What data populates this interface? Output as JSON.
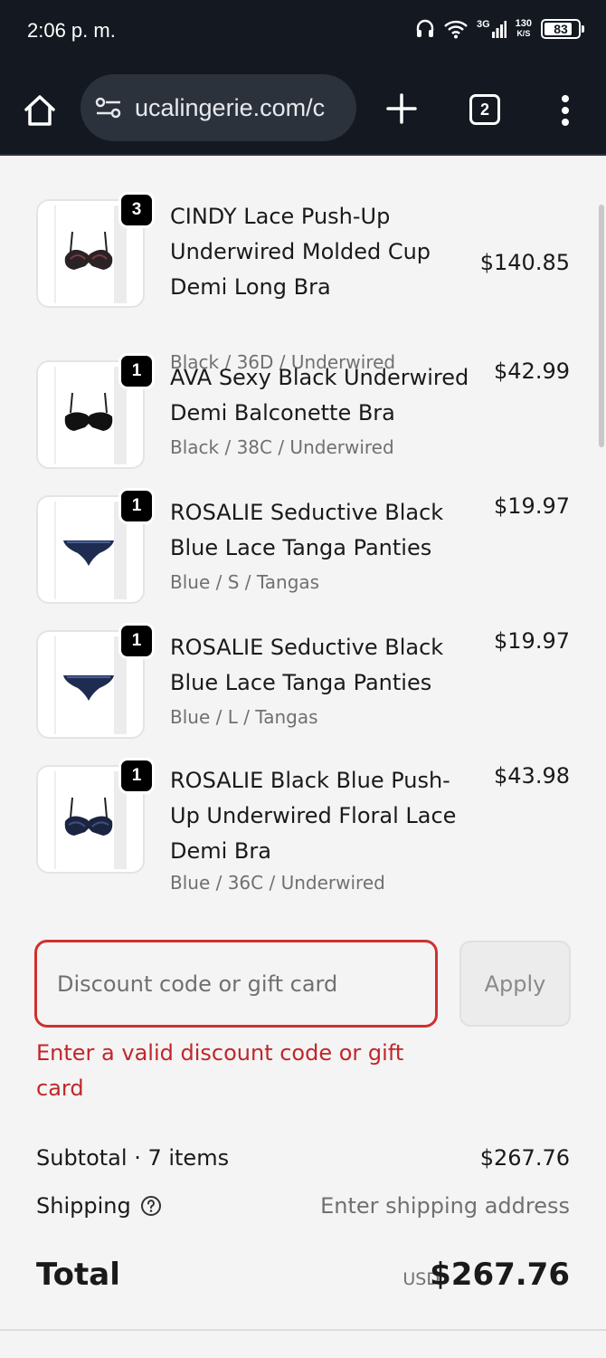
{
  "status_bar": {
    "time": "2:06 p. m.",
    "network": "3G",
    "speed_value": "130",
    "speed_unit": "K/S",
    "battery": "83",
    "battery_level": 0.83
  },
  "browser": {
    "url": "ucalingerie.com/c",
    "tab_count": "2",
    "icons": [
      "home-icon",
      "site-settings-icon",
      "plus-icon",
      "tabs-icon",
      "more-vert-icon"
    ]
  },
  "cart": {
    "items": [
      {
        "quantity": "3",
        "title": "CINDY Lace Push-Up Underwired Molded Cup Demi Long Bra",
        "variant": "Black / 36D / Underwired",
        "price": "$140.85"
      },
      {
        "quantity": "1",
        "title": "AVA Sexy Black Underwired Demi Balconette Bra",
        "variant": "Black / 38C / Underwired",
        "price": "$42.99"
      },
      {
        "quantity": "1",
        "title": "ROSALIE Seductive Black Blue Lace Tanga Panties",
        "variant": "Blue / S / Tangas",
        "price": "$19.97"
      },
      {
        "quantity": "1",
        "title": "ROSALIE Seductive Black Blue Lace Tanga Panties",
        "variant": "Blue / L / Tangas",
        "price": "$19.97"
      },
      {
        "quantity": "1",
        "title": "ROSALIE Black Blue Push-Up Underwired Floral Lace Demi Bra",
        "variant": "Blue / 36C / Underwired",
        "price": "$43.98"
      }
    ]
  },
  "discount": {
    "placeholder": "Discount code or gift card",
    "value": "",
    "apply_label": "Apply",
    "error": "Enter a valid discount code or gift card"
  },
  "summary": {
    "subtotal_label": "Subtotal · 7 items",
    "subtotal_value": "$267.76",
    "shipping_label": "Shipping",
    "shipping_value": "Enter shipping address",
    "total_label": "Total",
    "currency": "USD",
    "total_value": "$267.76"
  },
  "colors": {
    "error": "#c1262a",
    "chrome_bg": "#131821"
  }
}
